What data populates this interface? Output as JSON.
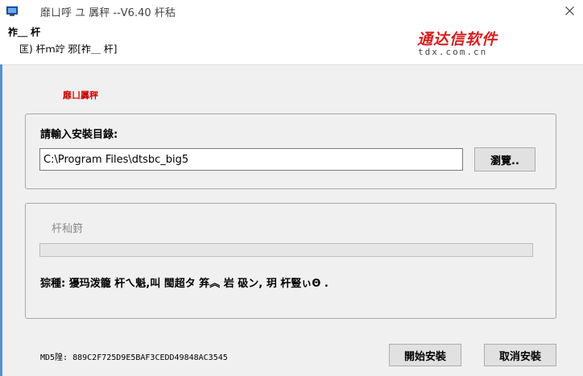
{
  "window": {
    "title": "靡ㄩ呼  ユ  羼秤  --V6.40  杆秙",
    "close_icon": "close-icon"
  },
  "header": {
    "line1": "祚＿  杆",
    "line2": "匡)   杆ｍ竚     邪[祚＿   杆]",
    "logo_main": "通达信软件",
    "logo_sub": "tdx.com.cn",
    "logo_color": "#d42020"
  },
  "section_title": "靡ㄩ羼秤",
  "install_dir": {
    "label": "請輸入安裝目錄:",
    "value": "C:\\Program Files\\dtsbc_big5",
    "browse_label": "瀏覽.."
  },
  "progress": {
    "label": "杆秈篈",
    "percent": 0,
    "status": "猔種:   獶玛泼籠   杆ㄟ魁,叫   閩超タ   笲︽   岩   砐ン,  玥   杆豎ぃΘ   ."
  },
  "footer": {
    "md5": "MD5隍: 889C2F725D9E5BAF3CEDD49848AC3545",
    "install_label": "開始安裝",
    "cancel_label": "取消安裝"
  }
}
